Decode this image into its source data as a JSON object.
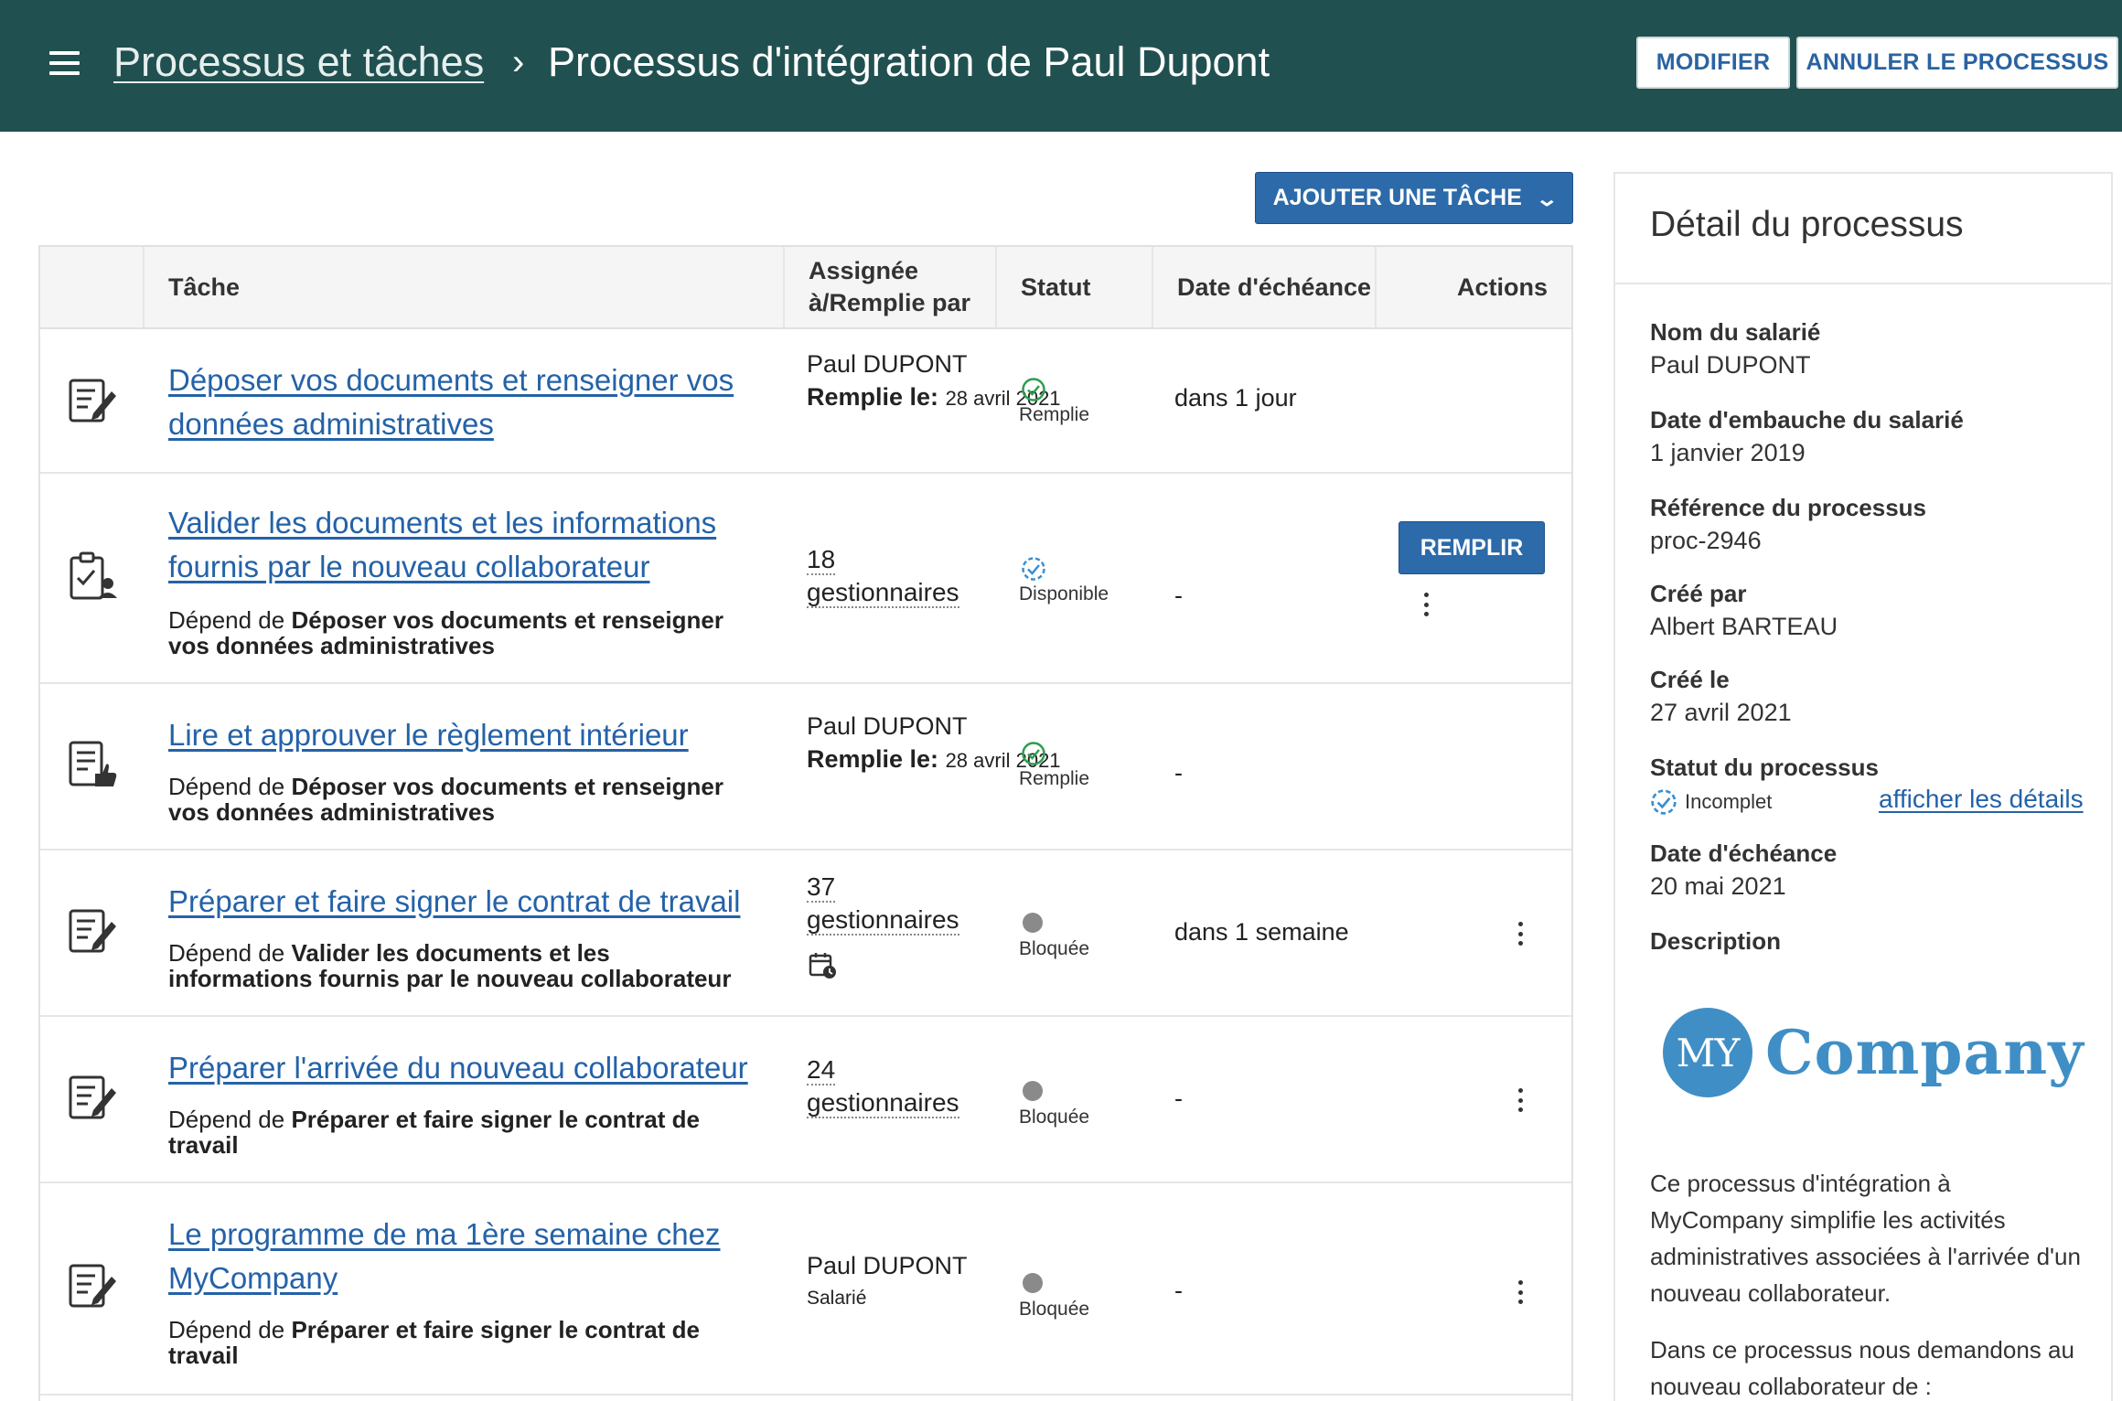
{
  "header": {
    "breadcrumb_parent": "Processus et tâches",
    "separator": "›",
    "title": "Processus d'intégration de Paul Dupont",
    "edit_label": "MODIFIER",
    "cancel_label": "ANNULER LE PROCESSUS",
    "bg_color": "#215050"
  },
  "toolbar": {
    "add_task_label": "AJOUTER UNE TÂCHE",
    "add_task_icon": "chevron-down-icon"
  },
  "table": {
    "columns": {
      "task": "Tâche",
      "assignee": "Assignée à/Remplie par",
      "status": "Statut",
      "due": "Date d'échéance",
      "actions": "Actions"
    },
    "depends_prefix": "Dépend de",
    "rows": [
      {
        "icon": "form-edit-icon",
        "title": "Déposer vos documents et renseigner vos données administratives",
        "assignee": "Paul DUPONT",
        "filled_label": "Remplie le:",
        "filled_date": "28 avril 2021",
        "status": "Remplie",
        "due": "dans 1 jour"
      },
      {
        "icon": "clipboard-user-icon",
        "title": "Valider les documents et les informations fournis par le nouveau collaborateur",
        "depends_on": "Déposer vos documents et renseigner vos données administratives",
        "assignee_count": "18",
        "assignee_group": "gestionnaires",
        "status": "Disponible",
        "due": "-",
        "action_label": "REMPLIR"
      },
      {
        "icon": "document-thumb-icon",
        "title": "Lire et approuver le règlement intérieur",
        "depends_on": "Déposer vos documents et renseigner vos données administratives",
        "assignee": "Paul DUPONT",
        "filled_label": "Remplie le:",
        "filled_date": "28 avril 2021",
        "status": "Remplie",
        "due": "-"
      },
      {
        "icon": "form-edit-icon",
        "title": "Préparer et faire signer le contrat de travail",
        "depends_on": "Valider les documents et les informations fournis par le nouveau collaborateur",
        "assignee_count": "37",
        "assignee_group": "gestionnaires",
        "status": "Bloquée",
        "due": "dans 1 semaine"
      },
      {
        "icon": "form-edit-icon",
        "title": "Préparer l'arrivée du nouveau collaborateur",
        "depends_on": "Préparer et faire signer le contrat de travail",
        "assignee_count": "24",
        "assignee_group": "gestionnaires",
        "status": "Bloquée",
        "due": "-"
      },
      {
        "icon": "form-edit-icon",
        "title": "Le programme de ma 1ère semaine chez MyCompany",
        "depends_on": "Préparer et faire signer le contrat de travail",
        "assignee": "Paul DUPONT",
        "assignee_role": "Salarié",
        "status": "Bloquée",
        "due": "-"
      }
    ]
  },
  "panel": {
    "title": "Détail du processus",
    "employee_label": "Nom du salarié",
    "employee_value": "Paul DUPONT",
    "hire_label": "Date d'embauche du salarié",
    "hire_value": "1 janvier 2019",
    "ref_label": "Référence du processus",
    "ref_value": "proc-2946",
    "created_by_label": "Créé par",
    "created_by_value": "Albert BARTEAU",
    "created_on_label": "Créé le",
    "created_on_value": "27 avril 2021",
    "status_label": "Statut du processus",
    "status_value": "Incomplet",
    "details_link": "afficher les détails",
    "due_label": "Date d'échéance",
    "due_value": "20 mai 2021",
    "description_label": "Description",
    "logo_circle_text": "MY",
    "logo_text": "Company",
    "description_p1": "Ce processus d'intégration à MyCompany simplifie les activités administratives associées à l'arrivée d'un nouveau collaborateur.",
    "description_p2": "Dans ce processus nous demandons au nouveau collaborateur de :"
  },
  "colors": {
    "accent": "#2c6aaa",
    "link": "#2462a8",
    "success": "#2e9d4e",
    "available": "#3a8fd0",
    "blocked": "#8a8a8a",
    "logo": "#3f8fc6"
  }
}
